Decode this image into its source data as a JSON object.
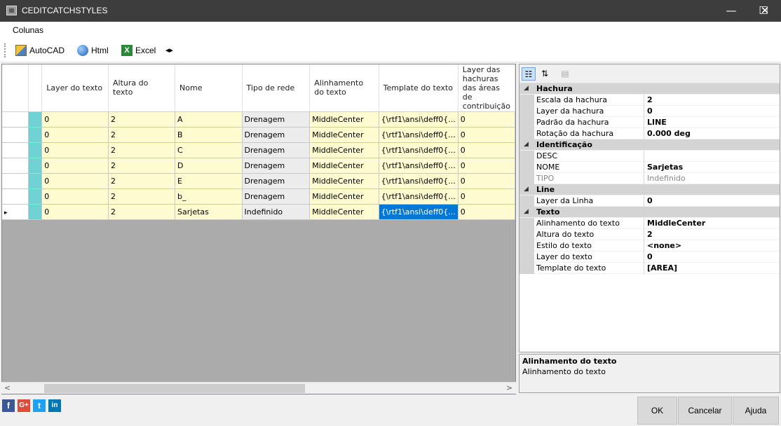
{
  "window": {
    "title": "CEDITCATCHSTYLES",
    "minimize": "—",
    "maximize": "☐",
    "close": "✕"
  },
  "menu": {
    "colunas": "Colunas"
  },
  "toolbar": {
    "autocad": "AutoCAD",
    "html": "Html",
    "excel": "Excel",
    "arrows": "◂▸"
  },
  "grid": {
    "headers": [
      "Layer do texto",
      "Altura do texto",
      "Nome",
      "Tipo de rede",
      "Alinhamento do texto",
      "Template do texto",
      "Layer das hachuras das áreas de contribuição"
    ],
    "rows": [
      [
        "0",
        "2",
        "A",
        "Drenagem",
        "MiddleCenter",
        "{\\rtf1\\ansi\\deff0{...",
        "0"
      ],
      [
        "0",
        "2",
        "B",
        "Drenagem",
        "MiddleCenter",
        "{\\rtf1\\ansi\\deff0{...",
        "0"
      ],
      [
        "0",
        "2",
        "C",
        "Drenagem",
        "MiddleCenter",
        "{\\rtf1\\ansi\\deff0{...",
        "0"
      ],
      [
        "0",
        "2",
        "D",
        "Drenagem",
        "MiddleCenter",
        "{\\rtf1\\ansi\\deff0{...",
        "0"
      ],
      [
        "0",
        "2",
        "E",
        "Drenagem",
        "MiddleCenter",
        "{\\rtf1\\ansi\\deff0{...",
        "0"
      ],
      [
        "0",
        "2",
        "b_",
        "Drenagem",
        "MiddleCenter",
        "{\\rtf1\\ansi\\deff0{...",
        "0"
      ],
      [
        "0",
        "2",
        "Sarjetas",
        "Indefinido",
        "MiddleCenter",
        "{\\rtf1\\ansi\\deff0{...",
        "0"
      ]
    ],
    "current_row_marker": "▸"
  },
  "scroll": {
    "left": "<",
    "right": ">"
  },
  "props": {
    "cats": [
      {
        "label": "Hachura",
        "rows": [
          {
            "name": "Escala da hachura",
            "value": "2"
          },
          {
            "name": "Layer da hachura",
            "value": "0"
          },
          {
            "name": "Padrão da hachura",
            "value": "LINE"
          },
          {
            "name": "Rotação da hachura",
            "value": "0.000 deg"
          }
        ]
      },
      {
        "label": "Identificação",
        "rows": [
          {
            "name": "DESC",
            "value": ""
          },
          {
            "name": "NOME",
            "value": "Sarjetas"
          },
          {
            "name": "TIPO",
            "value": "Indefinido"
          }
        ]
      },
      {
        "label": "Line",
        "rows": [
          {
            "name": "Layer da Linha",
            "value": "0"
          }
        ]
      },
      {
        "label": "Texto",
        "rows": [
          {
            "name": "Alinhamento do texto",
            "value": "MiddleCenter"
          },
          {
            "name": "Altura do texto",
            "value": "2"
          },
          {
            "name": "Estilo do texto",
            "value": "<none>"
          },
          {
            "name": "Layer do texto",
            "value": "0"
          },
          {
            "name": "Template do texto",
            "value": "[AREA]"
          }
        ]
      }
    ],
    "collapse_glyph": "◢"
  },
  "description": {
    "title": "Alinhamento do texto",
    "text": "Alinhamento do texto"
  },
  "social": {
    "facebook": "f",
    "gplus": "G+",
    "twitter": "t",
    "linkedin": "in"
  },
  "buttons": {
    "ok": "OK",
    "cancel": "Cancelar",
    "help": "Ajuda"
  }
}
